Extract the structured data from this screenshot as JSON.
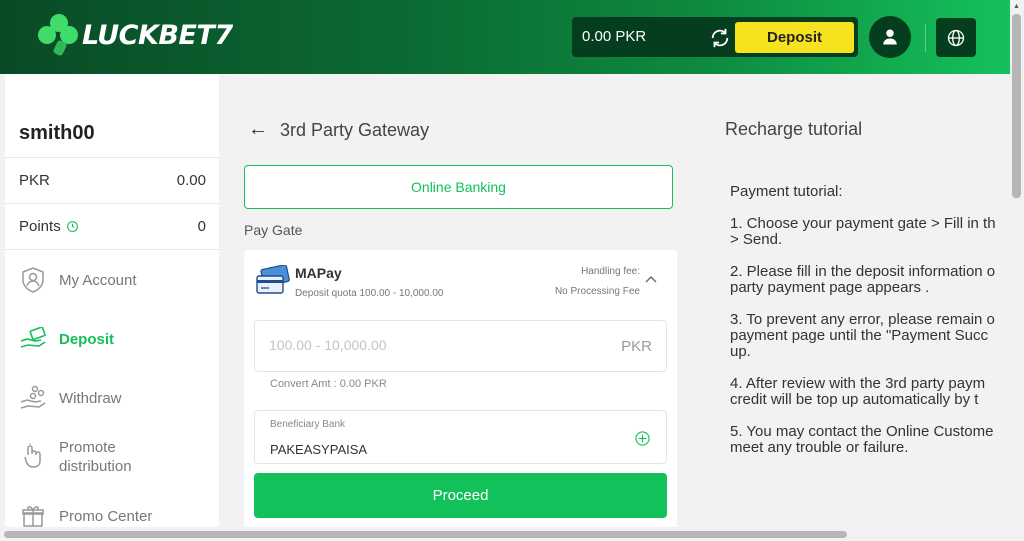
{
  "brand": {
    "logo_text": "LUCKBET7"
  },
  "header": {
    "balance": "0.00 PKR",
    "deposit_label": "Deposit",
    "icons": {
      "refresh": "refresh-icon",
      "user": "user-icon",
      "language": "globe-icon"
    }
  },
  "sidebar": {
    "username": "smith00",
    "currency_label": "PKR",
    "currency_value": "0.00",
    "points_label": "Points",
    "points_value": "0",
    "items": [
      {
        "label": "My Account",
        "icon": "shield-user-icon"
      },
      {
        "label": "Deposit",
        "icon": "deposit-hand-icon",
        "active": true
      },
      {
        "label": "Withdraw",
        "icon": "withdraw-hand-icon"
      },
      {
        "label": "Promote distribution",
        "line1": "Promote",
        "line2": "distribution",
        "icon": "promote-icon"
      },
      {
        "label": "Promo Center",
        "icon": "gift-icon"
      }
    ]
  },
  "main": {
    "title": "3rd Party Gateway",
    "method_label": "Online Banking",
    "paygate_label": "Pay Gate",
    "gate": {
      "name": "MAPay",
      "quota": "Deposit quota 100.00 - 10,000.00",
      "fee_label": "Handling fee:",
      "fee_value": "No Processing Fee"
    },
    "amount": {
      "placeholder": "100.00 - 10,000.00",
      "value": "",
      "currency": "PKR"
    },
    "convert_amt": "Convert Amt : 0.00 PKR",
    "bank": {
      "label": "Beneficiary Bank",
      "value": "PAKEASYPAISA"
    },
    "proceed_label": "Proceed"
  },
  "tutorial": {
    "title": "Recharge tutorial",
    "heading": "Payment tutorial:",
    "steps": [
      [
        "1. Choose your payment gate > Fill in th",
        "> Send."
      ],
      [
        "2. Please fill in the deposit information o",
        "party payment page appears ."
      ],
      [
        "3. To prevent any error, please remain o",
        "payment page until the \"Payment Succ",
        "up."
      ],
      [
        "4. After review with the 3rd party paym",
        "credit will be top up automatically by t"
      ],
      [
        "5. You may contact the Online Custome",
        "meet any trouble or failure."
      ]
    ]
  },
  "colors": {
    "accent": "#13c15a",
    "header_dark": "#0a4a25",
    "deposit_yellow": "#f6e21d"
  }
}
